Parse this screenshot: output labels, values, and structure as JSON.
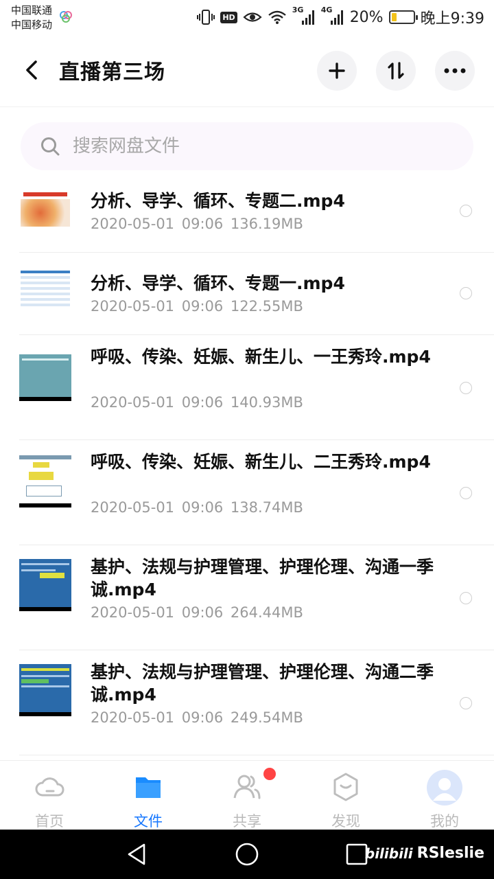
{
  "status": {
    "carrier1": "中国联通",
    "carrier2": "中国移动",
    "hd": "HD",
    "net1": "3G",
    "net2": "4G",
    "battery": "20%",
    "battery_level": 0.2,
    "time": "晚上9:39"
  },
  "header": {
    "title": "直播第三场"
  },
  "search": {
    "placeholder": "搜索网盘文件"
  },
  "files": [
    {
      "name": "分析、导学、循环、专题二.mp4",
      "meta": "2020-05-01  09:06  136.19MB",
      "thumb": "slide-red"
    },
    {
      "name": "分析、导学、循环、专题一.mp4",
      "meta": "2020-05-01  09:06  122.55MB",
      "thumb": "slide-table"
    },
    {
      "name": "呼吸、传染、妊娠、新生儿、一王秀玲.mp4",
      "meta": "2020-05-01  09:06  140.93MB",
      "thumb": "slide-teal"
    },
    {
      "name": "呼吸、传染、妊娠、新生儿、二王秀玲.mp4",
      "meta": "2020-05-01  09:06  138.74MB",
      "thumb": "slide-flow"
    },
    {
      "name": "基护、法规与护理管理、护理伦理、沟通一季诚.mp4",
      "meta": "2020-05-01  09:06  264.44MB",
      "thumb": "slide-blue"
    },
    {
      "name": "基护、法规与护理管理、护理伦理、沟通二季诚.mp4",
      "meta": "2020-05-01  09:06  249.54MB",
      "thumb": "slide-blue2"
    }
  ],
  "tabs": [
    {
      "label": "首页",
      "icon": "cloud-icon"
    },
    {
      "label": "文件",
      "icon": "folder-icon"
    },
    {
      "label": "共享",
      "icon": "people-icon"
    },
    {
      "label": "发现",
      "icon": "discover-icon"
    },
    {
      "label": "我的",
      "icon": "avatar-icon"
    }
  ],
  "watermark": {
    "logo": "bilibili",
    "user": "RSleslie"
  },
  "colors": {
    "accent": "#1677ff",
    "badge": "#ff4444",
    "battery": "#f2c21b"
  }
}
